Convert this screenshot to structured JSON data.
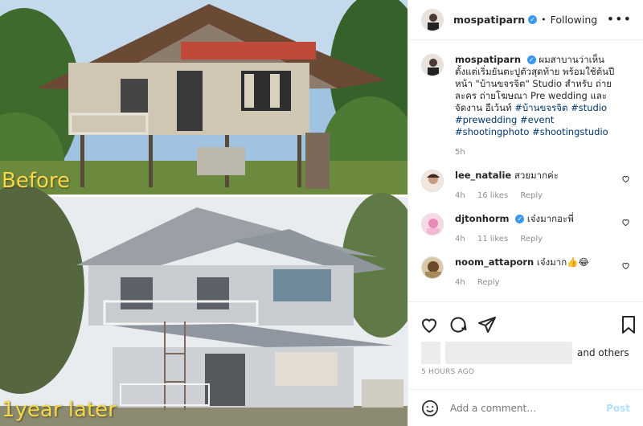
{
  "photo": {
    "before_label": "Before",
    "after_label": "1year later"
  },
  "header": {
    "username": "mospatiparn",
    "verified_mark": "✓",
    "separator": "•",
    "follow_status": "Following",
    "more_label": "•••"
  },
  "caption": {
    "username": "mospatiparn",
    "text": "ผมสาบานว่าเห็นตั้งแต่เริ่มยันตะปูตัวสุดท้าย พร้อมใช้ต้นปีหน้า \"บ้านขจรจิต\" Studio สำหรับ ถ่ายละคร ถ่ายโฆษณา Pre wedding และจัดงาน อีเว้นท์",
    "hashtags": "#บ้านขจรจิต #studio #prewedding #event #shootingphoto #shootingstudio",
    "time": "5h"
  },
  "comments": [
    {
      "username": "lee_natalie",
      "verified": false,
      "text": "สวยมากค่ะ",
      "time": "4h",
      "likes": "16 likes",
      "reply": "Reply"
    },
    {
      "username": "djtonhorm",
      "verified": true,
      "text": "เจ๋งมากอะพี่",
      "time": "4h",
      "likes": "11 likes",
      "reply": "Reply"
    },
    {
      "username": "noom_attaporn",
      "verified": false,
      "text": "เจ๋งมาก👍😂",
      "time": "4h",
      "likes": "",
      "reply": "Reply"
    }
  ],
  "likes": {
    "and_others": "and others"
  },
  "timestamp": "5 HOURS AGO",
  "add_comment": {
    "placeholder": "Add a comment…",
    "post_label": "Post"
  },
  "colors": {
    "link": "#00376b",
    "verified": "#3897f0",
    "muted": "#8e8e8e",
    "post_disabled": "#b2dffc",
    "overlay_text": "#f6d94a"
  },
  "icons": {
    "heart": "heart-icon",
    "comment": "comment-icon",
    "share": "share-icon",
    "save": "bookmark-icon",
    "emoji": "emoji-icon"
  }
}
